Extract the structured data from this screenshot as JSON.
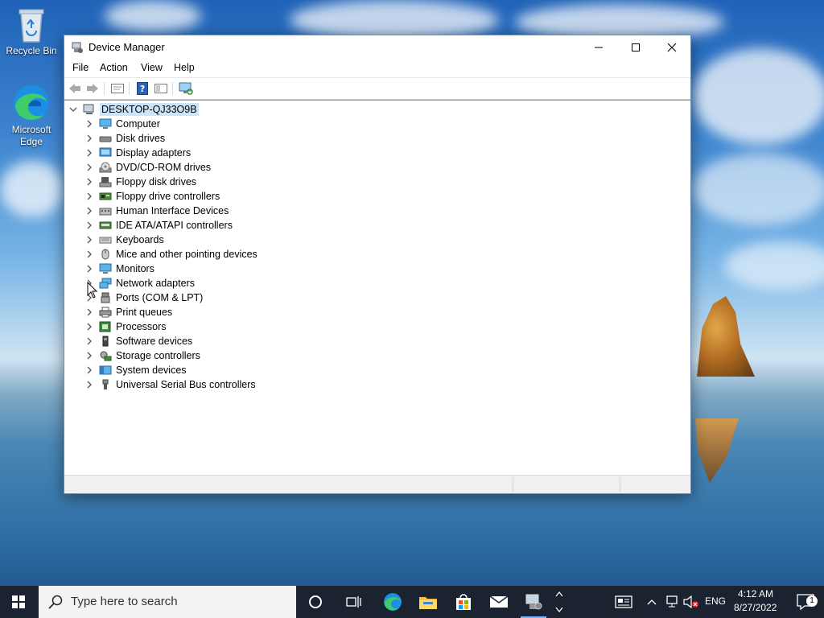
{
  "desktop": {
    "icons": [
      {
        "label": "Recycle Bin",
        "icon": "recycle-bin-icon"
      },
      {
        "label": "Microsoft Edge",
        "icon": "edge-icon"
      }
    ]
  },
  "window": {
    "title": "Device Manager",
    "menu": [
      "File",
      "Action",
      "View",
      "Help"
    ],
    "toolbar": [
      "back-icon",
      "forward-icon",
      "properties-icon",
      "help-icon",
      "show-hidden-icon",
      "scan-hardware-icon"
    ],
    "tree": {
      "root": "DESKTOP-QJ33O9B",
      "items": [
        {
          "label": "Computer",
          "icon": "computer-icon"
        },
        {
          "label": "Disk drives",
          "icon": "disk-drive-icon"
        },
        {
          "label": "Display adapters",
          "icon": "display-adapter-icon"
        },
        {
          "label": "DVD/CD-ROM drives",
          "icon": "dvd-drive-icon"
        },
        {
          "label": "Floppy disk drives",
          "icon": "floppy-drive-icon"
        },
        {
          "label": "Floppy drive controllers",
          "icon": "floppy-controller-icon"
        },
        {
          "label": "Human Interface Devices",
          "icon": "hid-icon"
        },
        {
          "label": "IDE ATA/ATAPI controllers",
          "icon": "ide-controller-icon"
        },
        {
          "label": "Keyboards",
          "icon": "keyboard-icon"
        },
        {
          "label": "Mice and other pointing devices",
          "icon": "mouse-icon"
        },
        {
          "label": "Monitors",
          "icon": "monitor-icon"
        },
        {
          "label": "Network adapters",
          "icon": "network-adapter-icon"
        },
        {
          "label": "Ports (COM & LPT)",
          "icon": "port-icon"
        },
        {
          "label": "Print queues",
          "icon": "printer-icon"
        },
        {
          "label": "Processors",
          "icon": "processor-icon"
        },
        {
          "label": "Software devices",
          "icon": "software-device-icon"
        },
        {
          "label": "Storage controllers",
          "icon": "storage-controller-icon"
        },
        {
          "label": "System devices",
          "icon": "system-device-icon"
        },
        {
          "label": "Universal Serial Bus controllers",
          "icon": "usb-icon"
        }
      ]
    }
  },
  "taskbar": {
    "search_placeholder": "Type here to search",
    "language": "ENG",
    "time": "4:12 AM",
    "date": "8/27/2022",
    "notification_count": "1"
  }
}
